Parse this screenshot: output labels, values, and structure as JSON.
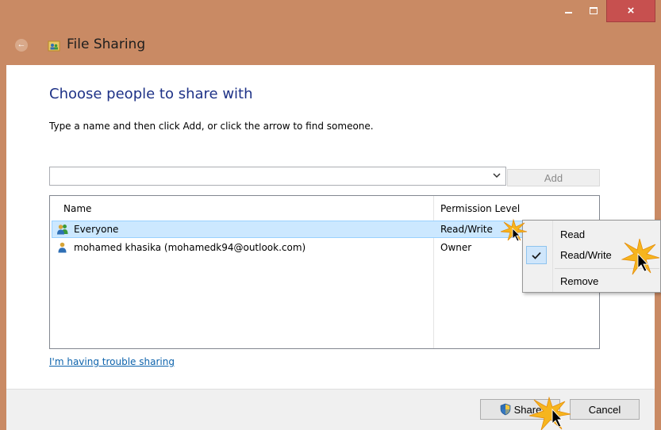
{
  "window": {
    "title": "File Sharing",
    "close_glyph": "×"
  },
  "page": {
    "heading": "Choose people to share with",
    "instruction": "Type a name and then click Add, or click the arrow to find someone.",
    "name_input_value": "",
    "add_label": "Add"
  },
  "list": {
    "columns": [
      "Name",
      "Permission Level"
    ],
    "rows": [
      {
        "name": "Everyone",
        "permission": "Read/Write",
        "icon": "group-icon"
      },
      {
        "name": "mohamed khasika (mohamedk94@outlook.com)",
        "permission": "Owner",
        "icon": "user-icon"
      }
    ]
  },
  "context_menu": {
    "items": [
      {
        "label": "Read",
        "checked": false
      },
      {
        "label": "Read/Write",
        "checked": true
      },
      {
        "label": "Remove",
        "checked": false
      }
    ]
  },
  "help_link": "I'm having trouble sharing",
  "footer": {
    "share_label": "Share",
    "cancel_label": "Cancel"
  },
  "colors": {
    "frame": "#c98a64",
    "heading": "#1e3287",
    "link": "#0d63ac",
    "selection": "#cce8ff",
    "close": "#c7504f"
  }
}
